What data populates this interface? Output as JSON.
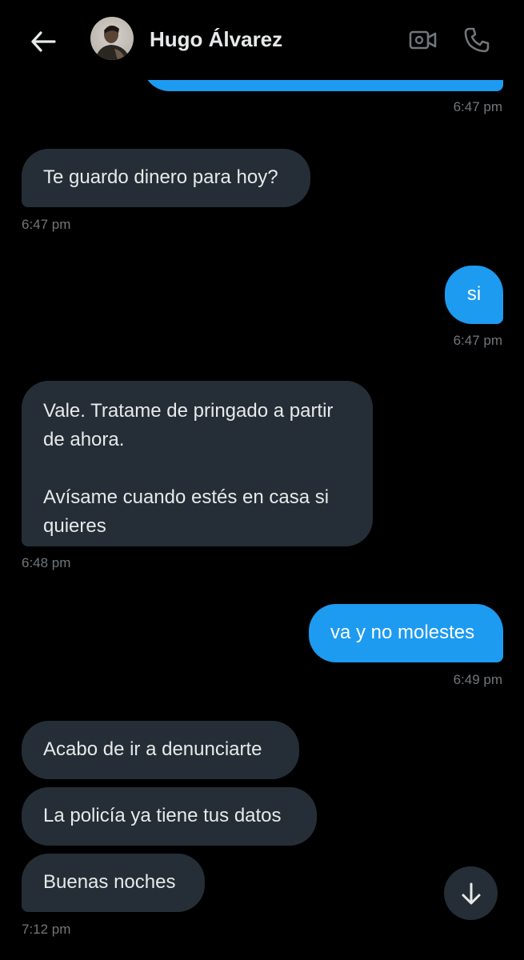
{
  "header": {
    "contact_name": "Hugo Álvarez"
  },
  "icons": {
    "back": "arrow-left-icon",
    "video": "video-camera-icon",
    "phone": "phone-icon",
    "scroll": "arrow-down-icon"
  },
  "colors": {
    "background": "#000000",
    "incoming_bubble": "#252e36",
    "outgoing_bubble": "#1d9bf0",
    "timestamp": "#71767b",
    "text": "#e7e9ea"
  },
  "messages": {
    "m0_time": "6:47 pm",
    "m1_text": "Te guardo dinero para hoy?",
    "m1_time": "6:47 pm",
    "m2_text": "si",
    "m2_time": "6:47 pm",
    "m3_text": "Vale. Tratame de pringado a partir\nde ahora.\n\nAvísame cuando estés en casa si\nquieres",
    "m3_time": "6:48 pm",
    "m4_text": "va y no molestes",
    "m4_time": "6:49 pm",
    "m5_text": "Acabo de ir a denunciarte",
    "m6_text": "La policía ya tiene tus datos",
    "m7_text": "Buenas noches",
    "m7_time": "7:12 pm"
  }
}
